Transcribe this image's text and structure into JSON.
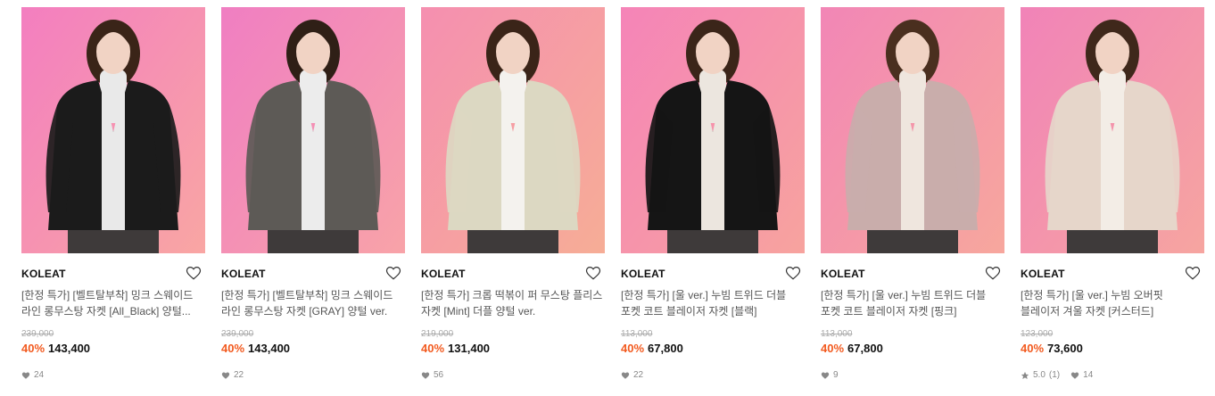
{
  "products": [
    {
      "brand": "KOLEAT",
      "title": "[한정 특가] [벨트탈부착] 밍크 스웨이드 라인 롱무스탕 자켓 [All_Black] 양털...",
      "original_price": "239,000",
      "discount": "40%",
      "price": "143,400",
      "likes": "24",
      "rating": "",
      "reviews": "",
      "image": {
        "jacket": "#1b1b1b",
        "inner": "#e9e9e9",
        "bg1": "#f37ec0",
        "bg2": "#f9a6a3",
        "hair": "#3a2418"
      }
    },
    {
      "brand": "KOLEAT",
      "title": "[한정 특가] [벨트탈부착] 밍크 스웨이드 라인 롱무스탕 자켓 [GRAY] 양털 ver.",
      "original_price": "239,000",
      "discount": "40%",
      "price": "143,400",
      "likes": "22",
      "rating": "",
      "reviews": "",
      "image": {
        "jacket": "#5d5a56",
        "inner": "#ececec",
        "bg1": "#f07ec2",
        "bg2": "#f8a3a8",
        "hair": "#2f1f16"
      }
    },
    {
      "brand": "KOLEAT",
      "title": "[한정 특가] 크롭 떡볶이 퍼 무스탕 플리스 자켓 [Mint] 더플 양털 ver.",
      "original_price": "219,000",
      "discount": "40%",
      "price": "131,400",
      "likes": "56",
      "rating": "",
      "reviews": "",
      "image": {
        "jacket": "#dcd8c2",
        "inner": "#f4f2ee",
        "bg1": "#f58fb0",
        "bg2": "#f6ad96",
        "hair": "#3a2418"
      }
    },
    {
      "brand": "KOLEAT",
      "title": "[한정 특가] [울 ver.] 누빔 트위드 더블 포켓 코트 블레이저 자켓 [블랙]",
      "original_price": "113,000",
      "discount": "40%",
      "price": "67,800",
      "likes": "22",
      "rating": "",
      "reviews": "",
      "image": {
        "jacket": "#151515",
        "inner": "#ece6df",
        "bg1": "#f584b8",
        "bg2": "#f7a39e",
        "hair": "#3b2519"
      }
    },
    {
      "brand": "KOLEAT",
      "title": "[한정 특가] [울 ver.] 누빔 트위드 더블 포켓 코트 블레이저 자켓 [핑크]",
      "original_price": "113,000",
      "discount": "40%",
      "price": "67,800",
      "likes": "9",
      "rating": "",
      "reviews": "",
      "image": {
        "jacket": "#c9adab",
        "inner": "#efe6de",
        "bg1": "#f286b6",
        "bg2": "#f7a79d",
        "hair": "#4a2f1f"
      }
    },
    {
      "brand": "KOLEAT",
      "title": "[한정 특가] [울 ver.] 누빔 오버핏 블레이저 겨울 자켓 [커스터드]",
      "original_price": "123,000",
      "discount": "40%",
      "price": "73,600",
      "likes": "14",
      "rating": "5.0",
      "reviews": "(1)",
      "image": {
        "jacket": "#e6d6ca",
        "inner": "#f3ede6",
        "bg1": "#f183b8",
        "bg2": "#f6a5a0",
        "hair": "#3f281b"
      }
    }
  ],
  "icons": {
    "wishlist": "heart-outline-icon",
    "like_count": "heart-icon",
    "rating": "star-icon"
  }
}
